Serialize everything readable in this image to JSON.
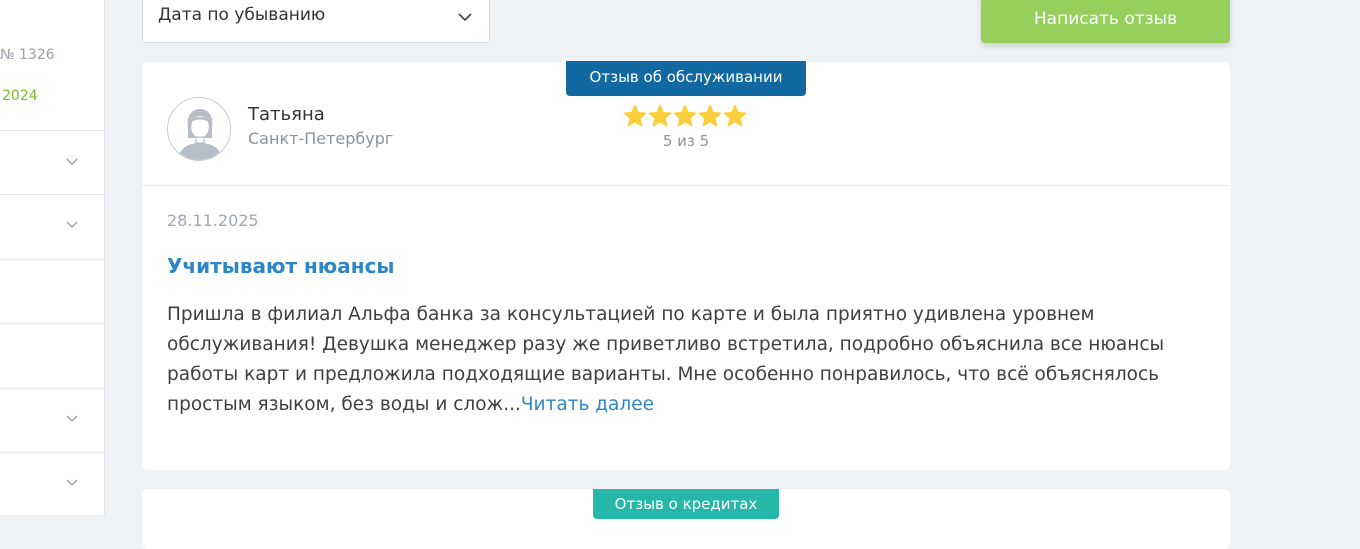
{
  "sidebar": {
    "partial_text_1": "№ 1326",
    "partial_text_2": "2024"
  },
  "sort": {
    "selected": "Дата по убыванию"
  },
  "write_review_label": "Написать отзыв",
  "reviews": [
    {
      "badge": "Отзыв об обслуживании",
      "badge_color": "#1268a0",
      "author": "Татьяна",
      "city": "Санкт-Петербург",
      "rating": 5,
      "rating_max": 5,
      "rating_text": "5 из 5",
      "date": "28.11.2025",
      "title": "Учитывают нюансы",
      "body": "Пришла в филиал Альфа банка за консультацией по карте и была приятно удивлена уровнем обслуживания! Девушка менеджер разу же приветливо встретила, подробно объяснила все нюансы работы карт и предложила подходящие варианты. Мне особенно понравилось, что всё объяснялось простым языком, без воды и слож...",
      "read_more": "Читать далее"
    },
    {
      "badge": "Отзыв о кредитах",
      "badge_color": "#25b8a9"
    }
  ],
  "colors": {
    "accent_link": "#2f86c6",
    "button_green": "#95cf5c",
    "star": "#f9cf3c"
  }
}
